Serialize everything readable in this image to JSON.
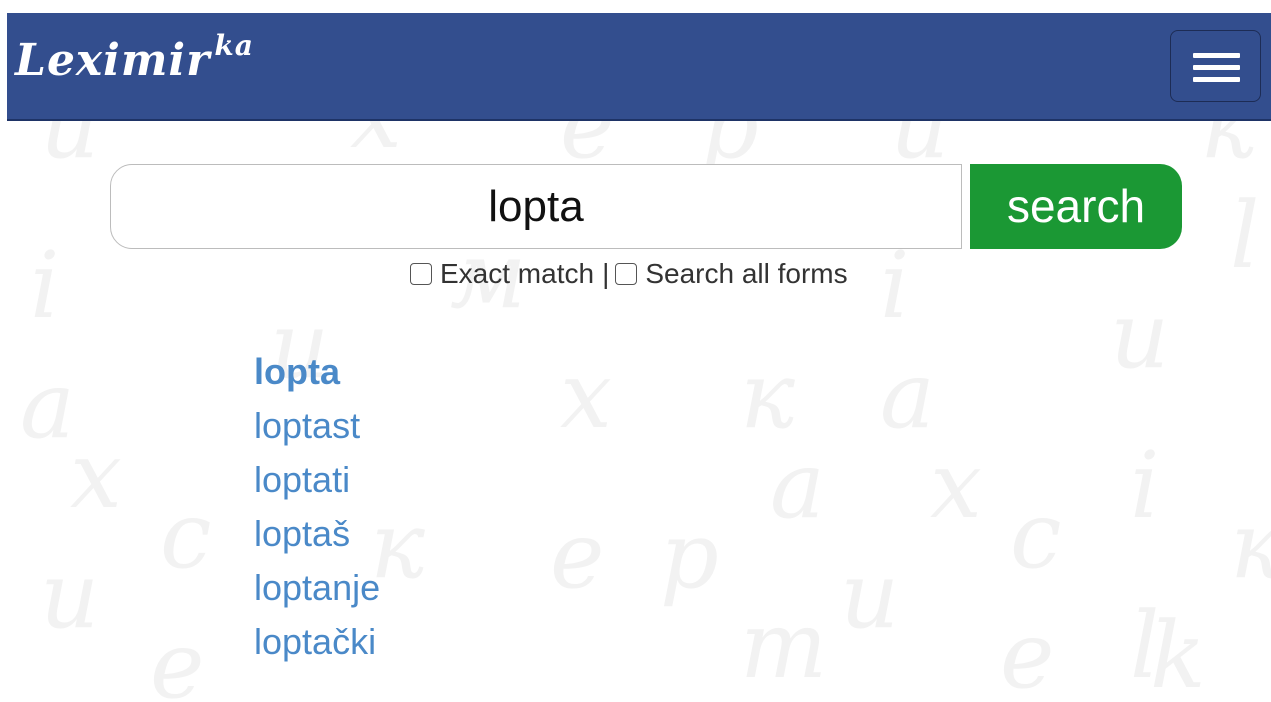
{
  "navbar": {
    "brand_main": "Leximir",
    "brand_sup": "ka",
    "menu_icon": "hamburger-icon",
    "color": "#334e8e"
  },
  "search": {
    "query": "lopta",
    "button_label": "search",
    "button_color": "#1b9834",
    "options": {
      "exact_match_label": "Exact match",
      "separator": "|",
      "search_all_forms_label": "Search all forms",
      "exact_match_checked": false,
      "search_all_forms_checked": false
    }
  },
  "results": [
    {
      "label": "lopta",
      "bold": true
    },
    {
      "label": "loptast",
      "bold": false
    },
    {
      "label": "loptati",
      "bold": false
    },
    {
      "label": "loptaš",
      "bold": false
    },
    {
      "label": "loptanje",
      "bold": false
    },
    {
      "label": "loptački",
      "bold": false
    }
  ],
  "link_color": "#4a89c8"
}
